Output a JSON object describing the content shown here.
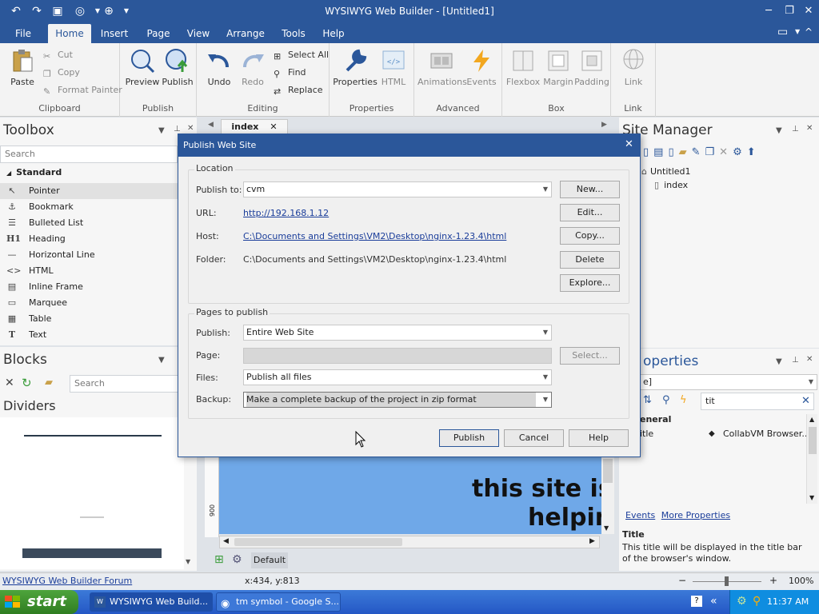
{
  "app": {
    "title": "WYSIWYG Web Builder - [Untitled1]"
  },
  "menu": {
    "tabs": [
      "File",
      "Home",
      "Insert",
      "Page",
      "View",
      "Arrange",
      "Tools",
      "Help"
    ],
    "active": "Home"
  },
  "ribbon": {
    "clipboard": {
      "label": "Clipboard",
      "paste": "Paste",
      "cut": "Cut",
      "copy": "Copy",
      "format_painter": "Format Painter"
    },
    "publish": {
      "label": "Publish",
      "preview": "Preview",
      "publish": "Publish"
    },
    "editing": {
      "label": "Editing",
      "undo": "Undo",
      "redo": "Redo",
      "select_all": "Select All",
      "find": "Find",
      "replace": "Replace"
    },
    "properties": {
      "label": "Properties",
      "properties": "Properties",
      "html": "HTML"
    },
    "advanced": {
      "label": "Advanced",
      "animations": "Animations",
      "events": "Events"
    },
    "box": {
      "label": "Box",
      "flexbox": "Flexbox",
      "margin": "Margin",
      "padding": "Padding"
    },
    "link": {
      "label": "Link",
      "link": "Link"
    }
  },
  "toolbox": {
    "title": "Toolbox",
    "search_placeholder": "Search",
    "section": "Standard",
    "items": [
      {
        "icon": "pointer-icon",
        "label": "Pointer"
      },
      {
        "icon": "anchor-icon",
        "label": "Bookmark"
      },
      {
        "icon": "list-icon",
        "label": "Bulleted List"
      },
      {
        "icon": "heading-icon",
        "label": "Heading"
      },
      {
        "icon": "hr-icon",
        "label": "Horizontal Line"
      },
      {
        "icon": "code-icon",
        "label": "HTML"
      },
      {
        "icon": "frame-icon",
        "label": "Inline Frame"
      },
      {
        "icon": "marquee-icon",
        "label": "Marquee"
      },
      {
        "icon": "table-icon",
        "label": "Table"
      },
      {
        "icon": "text-icon",
        "label": "Text"
      }
    ]
  },
  "blocks": {
    "title": "Blocks",
    "search_placeholder": "Search",
    "section": "Dividers"
  },
  "document_tab": {
    "label": "index"
  },
  "site_manager": {
    "title": "Site Manager",
    "root": "Untitled1",
    "child": "index"
  },
  "properties_panel": {
    "title": "operties",
    "field_value": "e]",
    "search_value": "tit",
    "category": "eneral",
    "row_name": "itle",
    "row_value": "CollabVM Browser...",
    "links": [
      "Events",
      "More Properties"
    ],
    "help_title": "Title",
    "help_text": "This title will be displayed in the title bar of the browser's window."
  },
  "canvas": {
    "text_line1": "this site is",
    "text_line2": "helpin",
    "ruler_mark": "900",
    "view_tab": "Default"
  },
  "dialog": {
    "title": "Publish Web Site",
    "location": {
      "legend": "Location",
      "publish_to_label": "Publish to:",
      "publish_to_value": "cvm",
      "url_label": "URL:",
      "url_value": "http://192.168.1.12",
      "host_label": "Host:",
      "host_value": "C:\\Documents and Settings\\VM2\\Desktop\\nginx-1.23.4\\html",
      "folder_label": "Folder:",
      "folder_value": "C:\\Documents and Settings\\VM2\\Desktop\\nginx-1.23.4\\html",
      "buttons": [
        "New...",
        "Edit...",
        "Copy...",
        "Delete",
        "Explore..."
      ]
    },
    "pages": {
      "legend": "Pages to publish",
      "publish_label": "Publish:",
      "publish_value": "Entire Web Site",
      "page_label": "Page:",
      "page_value": "",
      "select_button": "Select...",
      "files_label": "Files:",
      "files_value": "Publish all files",
      "backup_label": "Backup:",
      "backup_value": "Make a complete backup of the project in zip format"
    },
    "actions": {
      "publish": "Publish",
      "cancel": "Cancel",
      "help": "Help"
    }
  },
  "statusbar": {
    "forum_link": "WYSIWYG Web Builder Forum",
    "coords": "x:434, y:813",
    "zoom": "100%"
  },
  "taskbar": {
    "start": "start",
    "tasks": [
      "WYSIWYG Web Build...",
      "tm symbol - Google S..."
    ],
    "clock": "11:37 AM"
  },
  "colors": {
    "accent": "#2b579a",
    "canvas_blue": "#6fa8e8",
    "taskbar": "#245edb"
  }
}
